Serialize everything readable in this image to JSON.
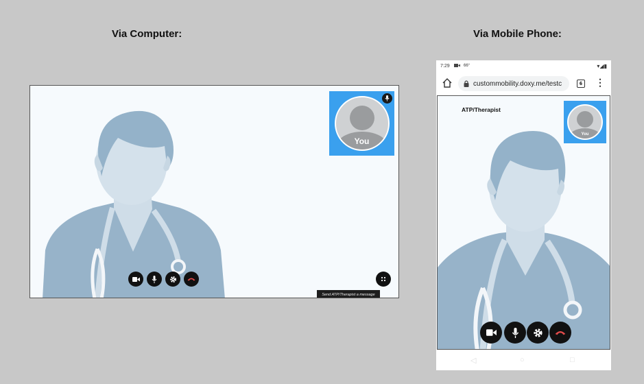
{
  "computer_section": {
    "title": "Via Computer:"
  },
  "mobile_section": {
    "title": "Via Mobile Phone:"
  },
  "desktop_call": {
    "self_view_label": "You",
    "message_bar_text": "Send ATP/Therapist a message",
    "controls": [
      "video-camera-icon",
      "microphone-icon",
      "settings-gear-icon",
      "end-call-icon"
    ],
    "accent_color": "#3aa0ee",
    "end_call_color": "#e24b4b"
  },
  "mobile": {
    "status_time": "7:29",
    "status_temp": "66°",
    "url": "custommobility.doxy.me/testc",
    "tab_count": "6",
    "remote_name": "ATP/Therapist",
    "self_view_label": "You"
  }
}
